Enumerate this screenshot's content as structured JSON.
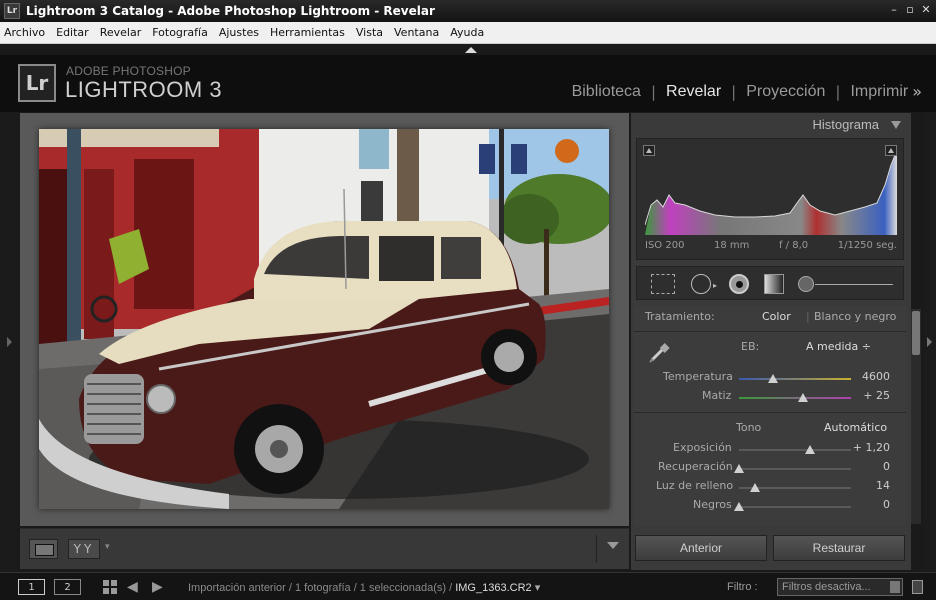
{
  "window": {
    "title": "Lightroom 3 Catalog - Adobe Photoshop Lightroom - Revelar",
    "icon": "Lr"
  },
  "menu": [
    "Archivo",
    "Editar",
    "Revelar",
    "Fotografía",
    "Ajustes",
    "Herramientas",
    "Vista",
    "Ventana",
    "Ayuda"
  ],
  "identity": {
    "logo": "Lr",
    "line1": "ADOBE PHOTOSHOP",
    "line2": "LIGHTROOM 3"
  },
  "modules": [
    {
      "label": "Biblioteca",
      "active": false
    },
    {
      "label": "Revelar",
      "active": true
    },
    {
      "label": "Proyección",
      "active": false
    },
    {
      "label": "Imprimir",
      "active": false
    }
  ],
  "histogram": {
    "title": "Histograma",
    "iso": "ISO 200",
    "focal": "18 mm",
    "aperture": "f / 8,0",
    "shutter": "1/1250 seg."
  },
  "basic": {
    "treatment_label": "Tratamiento:",
    "treatment_color": "Color",
    "treatment_bw": "Blanco y negro",
    "wb_label": "EB:",
    "wb_value": "A medida ÷",
    "temp_label": "Temperatura",
    "temp_value": "4600",
    "temp_pos": 0.3,
    "tint_label": "Matiz",
    "tint_value": "+ 25",
    "tint_pos": 0.57,
    "tone_label": "Tono",
    "auto_label": "Automático",
    "exposure_label": "Exposición",
    "exposure_value": "+ 1,20",
    "exposure_pos": 0.63,
    "recovery_label": "Recuperación",
    "recovery_value": "0",
    "recovery_pos": 0.0,
    "fill_label": "Luz de relleno",
    "fill_value": "14",
    "fill_pos": 0.14,
    "blacks_label": "Negros",
    "blacks_value": "0",
    "blacks_pos": 0.0
  },
  "buttons": {
    "previous": "Anterior",
    "reset": "Restaurar"
  },
  "filmstrip": {
    "screen1": "1",
    "screen2": "2",
    "path": "Importación anterior / 1 fotografía / 1 seleccionada(s) /",
    "filename": "IMG_1363.CR2",
    "filter_label": "Filtro :",
    "filter_value": "Filtros desactiva..."
  }
}
